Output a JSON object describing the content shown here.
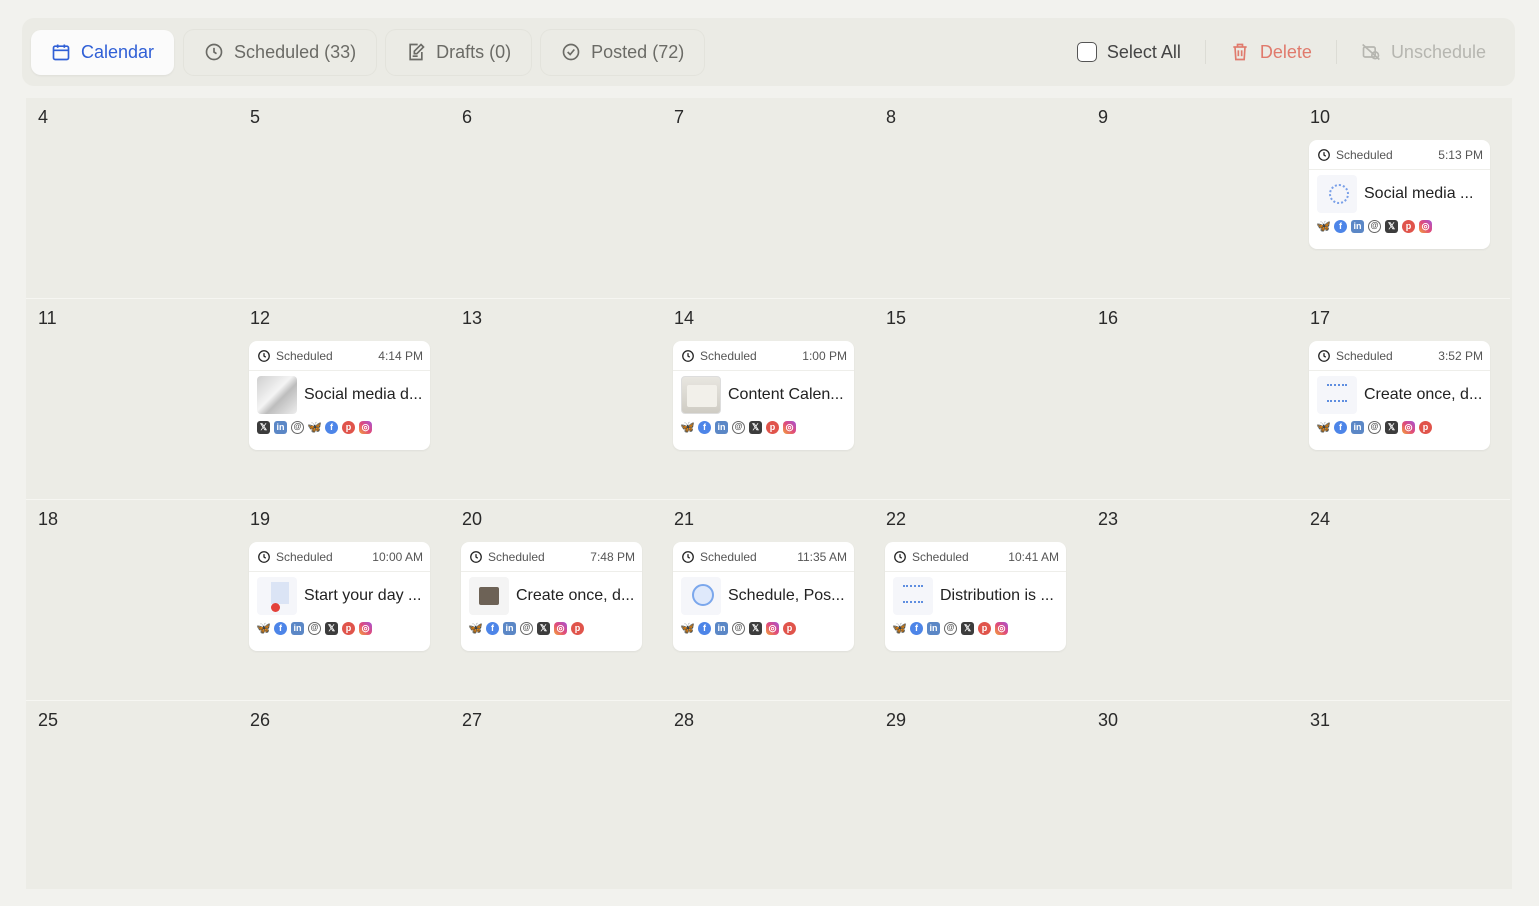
{
  "tabs": [
    {
      "label": "Calendar",
      "icon": "calendar-icon",
      "active": true
    },
    {
      "label": "Scheduled (33)",
      "icon": "clock-icon",
      "active": false
    },
    {
      "label": "Drafts (0)",
      "icon": "draft-edit-icon",
      "active": false
    },
    {
      "label": "Posted (72)",
      "icon": "check-circle-icon",
      "active": false
    }
  ],
  "actions": {
    "select_all": "Select All",
    "delete": "Delete",
    "unschedule": "Unschedule"
  },
  "colors": {
    "accent": "#2f5fd6",
    "delete": "#e07a6c",
    "disabled": "#b6b6b0"
  },
  "days": [
    "4",
    "5",
    "6",
    "7",
    "8",
    "9",
    "10",
    "11",
    "12",
    "13",
    "14",
    "15",
    "16",
    "17",
    "18",
    "19",
    "20",
    "21",
    "22",
    "23",
    "24",
    "25",
    "26",
    "27",
    "28",
    "29",
    "30",
    "31"
  ],
  "posts": [
    {
      "day": "10",
      "status": "Scheduled",
      "time": "5:13 PM",
      "title": "Social media ...",
      "thumb": "diagram",
      "networks": [
        "bluesky",
        "facebook",
        "linkedin",
        "threads",
        "x",
        "pinterest",
        "instagram"
      ]
    },
    {
      "day": "12",
      "status": "Scheduled",
      "time": "4:14 PM",
      "title": "Social media d...",
      "thumb": "photo",
      "networks": [
        "x",
        "linkedin",
        "threads",
        "bluesky",
        "facebook",
        "pinterest",
        "instagram"
      ]
    },
    {
      "day": "14",
      "status": "Scheduled",
      "time": "1:00 PM",
      "title": "Content Calen...",
      "thumb": "screen",
      "networks": [
        "bluesky",
        "facebook",
        "linkedin",
        "threads",
        "x",
        "pinterest",
        "instagram"
      ]
    },
    {
      "day": "17",
      "status": "Scheduled",
      "time": "3:52 PM",
      "title": "Create once, d...",
      "thumb": "diagram2",
      "networks": [
        "bluesky",
        "facebook",
        "linkedin",
        "threads",
        "x",
        "instagram",
        "pinterest"
      ]
    },
    {
      "day": "19",
      "status": "Scheduled",
      "time": "10:00 AM",
      "title": "Start your day ...",
      "thumb": "collage",
      "networks": [
        "bluesky",
        "facebook",
        "linkedin",
        "threads",
        "x",
        "pinterest",
        "instagram"
      ]
    },
    {
      "day": "20",
      "status": "Scheduled",
      "time": "7:48 PM",
      "title": "Create once, d...",
      "thumb": "room",
      "networks": [
        "bluesky",
        "facebook",
        "linkedin",
        "threads",
        "x",
        "instagram",
        "pinterest"
      ]
    },
    {
      "day": "21",
      "status": "Scheduled",
      "time": "11:35 AM",
      "title": "Schedule, Pos...",
      "thumb": "globe",
      "networks": [
        "bluesky",
        "facebook",
        "linkedin",
        "threads",
        "x",
        "instagram",
        "pinterest"
      ]
    },
    {
      "day": "22",
      "status": "Scheduled",
      "time": "10:41 AM",
      "title": "Distribution is ...",
      "thumb": "diagram2",
      "networks": [
        "bluesky",
        "facebook",
        "linkedin",
        "threads",
        "x",
        "pinterest",
        "instagram"
      ]
    }
  ]
}
